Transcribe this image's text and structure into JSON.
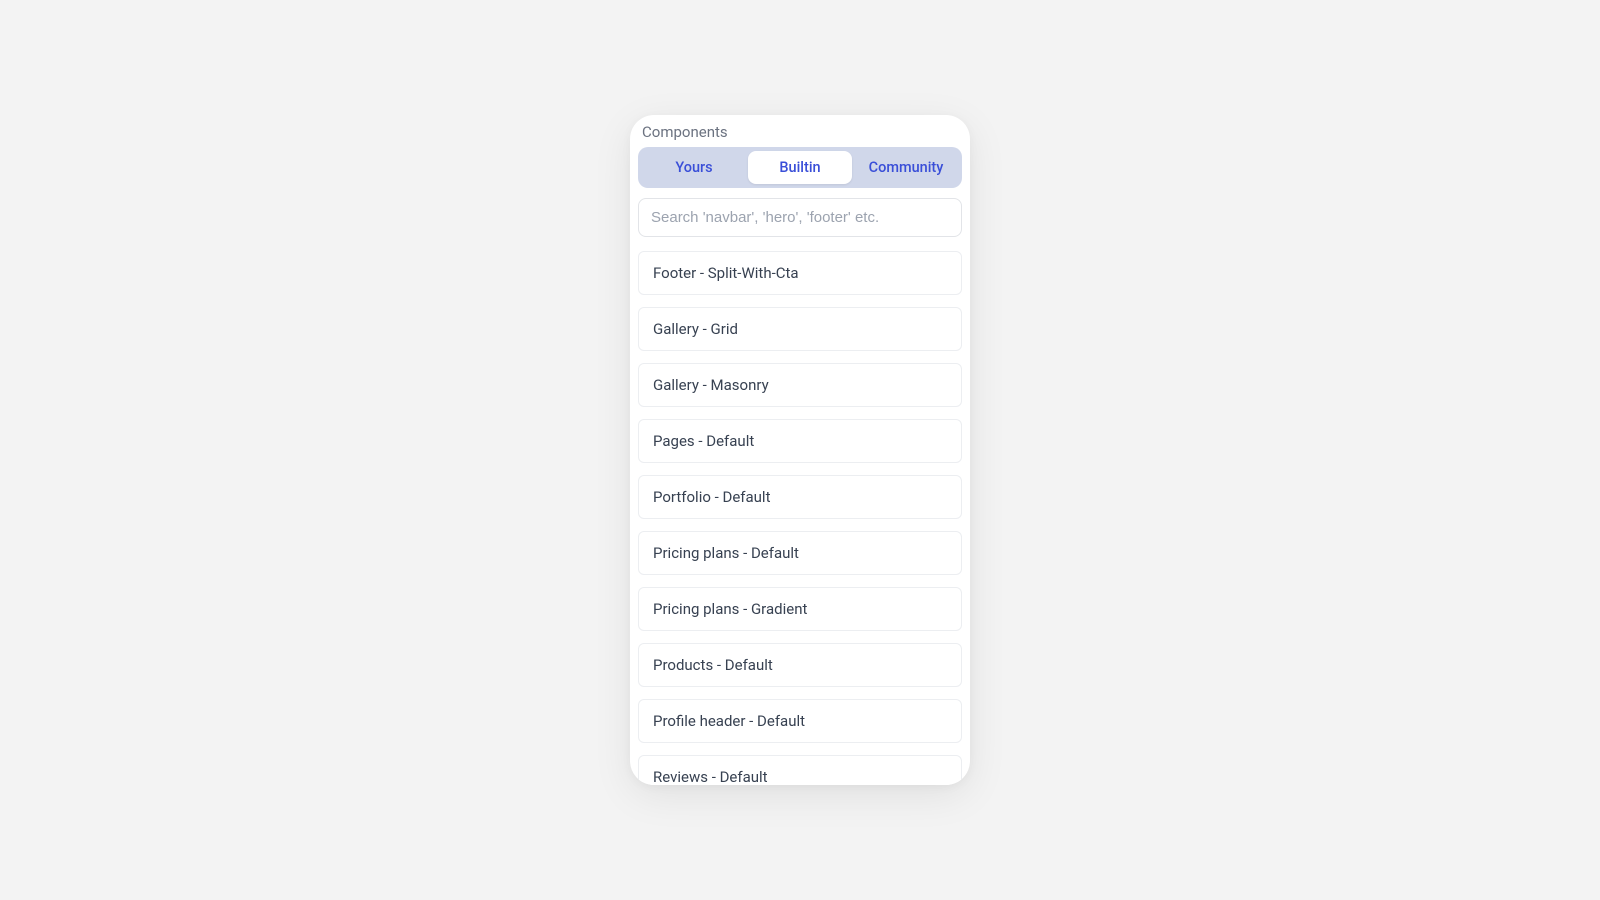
{
  "title": "Components",
  "tabs": {
    "yours": "Yours",
    "builtin": "Builtin",
    "community": "Community"
  },
  "active_tab": "builtin",
  "search": {
    "placeholder": "Search 'navbar', 'hero', 'footer' etc."
  },
  "items": [
    {
      "label": "Footer - Split-With-Cta"
    },
    {
      "label": "Gallery - Grid"
    },
    {
      "label": "Gallery - Masonry"
    },
    {
      "label": "Pages - Default"
    },
    {
      "label": "Portfolio - Default"
    },
    {
      "label": "Pricing plans - Default"
    },
    {
      "label": "Pricing plans - Gradient"
    },
    {
      "label": "Products - Default"
    },
    {
      "label": "Profile header - Default"
    },
    {
      "label": "Reviews - Default"
    }
  ]
}
